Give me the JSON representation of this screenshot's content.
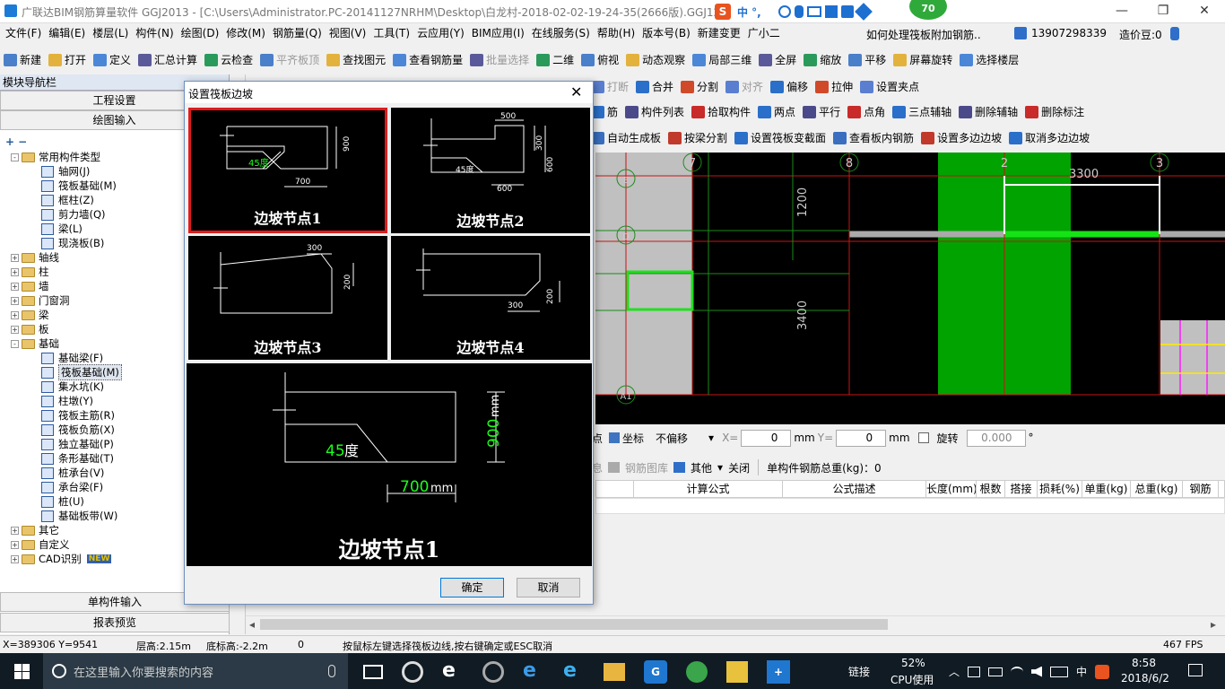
{
  "window": {
    "title": "广联达BIM钢筋算量软件 GGJ2013 - [C:\\Users\\Administrator.PC-20141127NRHM\\Desktop\\白龙村-2018-02-02-19-24-35(2666版).GGJ12]",
    "badge": "70",
    "ime": "中 °,"
  },
  "menu": [
    "文件(F)",
    "编辑(E)",
    "楼层(L)",
    "构件(N)",
    "绘图(D)",
    "修改(M)",
    "钢筋量(Q)",
    "视图(V)",
    "工具(T)",
    "云应用(Y)",
    "BIM应用(I)",
    "在线服务(S)",
    "帮助(H)",
    "版本号(B)",
    "新建变更",
    "广小二"
  ],
  "menu_right": {
    "link": "如何处理筏板附加钢筋..",
    "phone": "13907298339",
    "price": "造价豆:0"
  },
  "toolbar1": [
    "新建",
    "打开",
    "定义",
    "汇总计算",
    "云检查",
    "平齐板顶",
    "查找图元",
    "查看钢筋量",
    "批量选择",
    "二维",
    "俯视",
    "动态观察",
    "局部三维",
    "全屏",
    "缩放",
    "平移",
    "屏幕旋转",
    "选择楼层"
  ],
  "toolbar2": [
    "打断",
    "合并",
    "分割",
    "对齐",
    "偏移",
    "拉伸",
    "设置夹点"
  ],
  "toolbar3": [
    "筋",
    "构件列表",
    "拾取构件",
    "两点",
    "平行",
    "点角",
    "三点辅轴",
    "删除辅轴",
    "删除标注"
  ],
  "toolbar4": [
    "自动生成板",
    "按梁分割",
    "设置筏板变截面",
    "查看板内钢筋",
    "设置多边边坡",
    "取消多边边坡"
  ],
  "left": {
    "title": "模块导航栏",
    "btn1": "工程设置",
    "btn2": "绘图输入",
    "tree": [
      {
        "level": 0,
        "exp": "-",
        "label": "常用构件类型",
        "folder": true
      },
      {
        "level": 1,
        "label": "轴网(J)"
      },
      {
        "level": 1,
        "label": "筏板基础(M)"
      },
      {
        "level": 1,
        "label": "框柱(Z)"
      },
      {
        "level": 1,
        "label": "剪力墙(Q)"
      },
      {
        "level": 1,
        "label": "梁(L)"
      },
      {
        "level": 1,
        "label": "现浇板(B)"
      },
      {
        "level": 0,
        "exp": "+",
        "label": "轴线",
        "folder": true
      },
      {
        "level": 0,
        "exp": "+",
        "label": "柱",
        "folder": true
      },
      {
        "level": 0,
        "exp": "+",
        "label": "墙",
        "folder": true
      },
      {
        "level": 0,
        "exp": "+",
        "label": "门窗洞",
        "folder": true
      },
      {
        "level": 0,
        "exp": "+",
        "label": "梁",
        "folder": true
      },
      {
        "level": 0,
        "exp": "+",
        "label": "板",
        "folder": true
      },
      {
        "level": 0,
        "exp": "-",
        "label": "基础",
        "folder": true
      },
      {
        "level": 1,
        "label": "基础梁(F)"
      },
      {
        "level": 1,
        "label": "筏板基础(M)",
        "selected": true
      },
      {
        "level": 1,
        "label": "集水坑(K)"
      },
      {
        "level": 1,
        "label": "柱墩(Y)"
      },
      {
        "level": 1,
        "label": "筏板主筋(R)"
      },
      {
        "level": 1,
        "label": "筏板负筋(X)"
      },
      {
        "level": 1,
        "label": "独立基础(P)"
      },
      {
        "level": 1,
        "label": "条形基础(T)"
      },
      {
        "level": 1,
        "label": "桩承台(V)"
      },
      {
        "level": 1,
        "label": "承台梁(F)"
      },
      {
        "level": 1,
        "label": "桩(U)"
      },
      {
        "level": 1,
        "label": "基础板带(W)"
      },
      {
        "level": 0,
        "exp": "+",
        "label": "其它",
        "folder": true
      },
      {
        "level": 0,
        "exp": "+",
        "label": "自定义",
        "folder": true
      },
      {
        "level": 0,
        "exp": "+",
        "label": "CAD识别",
        "folder": true,
        "new": "NEW"
      }
    ],
    "btn3": "单构件输入",
    "btn4": "报表预览"
  },
  "dialog": {
    "title": "设置筏板边坡",
    "thumbs": [
      "边坡节点1",
      "边坡节点2",
      "边坡节点3",
      "边坡节点4"
    ],
    "t1": {
      "angle": "45度",
      "w": "700",
      "h": "900",
      "unit": "mm"
    },
    "t2": {
      "a": "500",
      "b": "300",
      "c": "600",
      "d": "600",
      "angle": "45度",
      "unit": "mm"
    },
    "t3": {
      "a": "300",
      "b": "200",
      "unit": "mm"
    },
    "t4": {
      "a": "300",
      "b": "200",
      "unit": "mm"
    },
    "preview": {
      "angle_num": "45",
      "angle_unit": "度",
      "w": "700",
      "h": "900",
      "unit": "mm",
      "label": "边坡节点1"
    },
    "ok": "确定",
    "cancel": "取消"
  },
  "cad": {
    "axes": [
      "7",
      "8",
      "2",
      "3",
      "E",
      "D",
      "A1"
    ],
    "dims": [
      "1200",
      "3400",
      "3300"
    ]
  },
  "coordbar": {
    "pt": "点",
    "coord": "坐标",
    "offset": "不偏移",
    "x_label": "X=",
    "x": "0",
    "y_label": "Y=",
    "y": "0",
    "mm": "mm",
    "rotate": "旋转",
    "rot": "0.000",
    "deg": "°"
  },
  "detail": {
    "info": "息",
    "lib": "钢筋图库",
    "other": "其他",
    "close": "关闭",
    "total": "单构件钢筋总重(kg)：0",
    "cols": [
      "",
      "计算公式",
      "公式描述",
      "长度(mm)",
      "根数",
      "搭接",
      "损耗(%)",
      "单重(kg)",
      "总重(kg)",
      "钢筋"
    ]
  },
  "status": {
    "xy": "X=389306 Y=9541",
    "floor_h": "层高:2.15m",
    "base_h": "底标高:-2.2m",
    "zero": "0",
    "hint": "按鼠标左键选择筏板边线,按右键确定或ESC取消",
    "fps": "467 FPS"
  },
  "taskbar": {
    "search": "在这里输入你要搜索的内容",
    "link": "链接",
    "cpu": "52%",
    "cpu_label": "CPU使用",
    "lang": "中",
    "time": "8:58",
    "date": "2018/6/2"
  }
}
